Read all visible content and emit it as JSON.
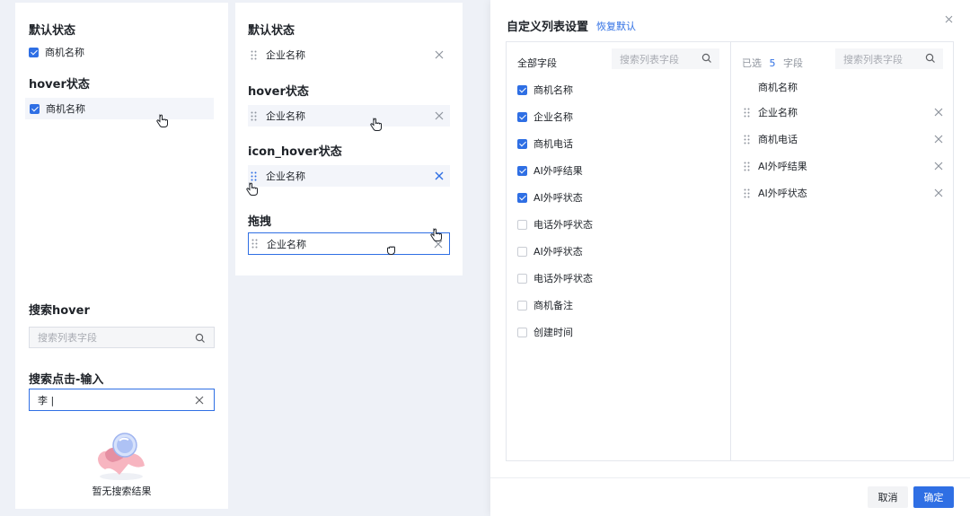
{
  "left_panel": {
    "default_title": "默认状态",
    "default_item": "商机名称",
    "hover_title": "hover状态",
    "hover_item": "商机名称",
    "search_hover_title": "搜索hover",
    "search_placeholder": "搜索列表字段",
    "search_input_title": "搜索点击-输入",
    "search_input_value": "李 |",
    "empty_text": "暂无搜索结果"
  },
  "middle_panel": {
    "default_title": "默认状态",
    "default_item": "企业名称",
    "hover_title": "hover状态",
    "hover_item": "企业名称",
    "icon_hover_title": "icon_hover状态",
    "icon_hover_item": "企业名称",
    "drag_title": "拖拽",
    "drag_item": "企业名称"
  },
  "dialog": {
    "title": "自定义列表设置",
    "reset_link": "恢复默认",
    "all_fields_label": "全部字段",
    "search_placeholder_left": "搜索列表字段",
    "search_placeholder_right": "搜索列表字段",
    "selected_prefix": "已选",
    "selected_count": "5",
    "selected_suffix": "字段",
    "all_fields": [
      {
        "label": "商机名称",
        "checked": true
      },
      {
        "label": "企业名称",
        "checked": true
      },
      {
        "label": "商机电话",
        "checked": true
      },
      {
        "label": "AI外呼结果",
        "checked": true
      },
      {
        "label": "AI外呼状态",
        "checked": true
      },
      {
        "label": "电话外呼状态",
        "checked": false
      },
      {
        "label": "AI外呼状态",
        "checked": false
      },
      {
        "label": "电话外呼状态",
        "checked": false
      },
      {
        "label": "商机备注",
        "checked": false
      },
      {
        "label": "创建时间",
        "checked": false
      }
    ],
    "fixed_field": "商机名称",
    "selected_fields": [
      "企业名称",
      "商机电话",
      "AI外呼结果",
      "AI外呼状态"
    ],
    "cancel_label": "取消",
    "confirm_label": "确定"
  },
  "colors": {
    "accent": "#2f6fe4",
    "hover_bg": "#f3f5fa",
    "page_bg": "#eef1f7"
  }
}
